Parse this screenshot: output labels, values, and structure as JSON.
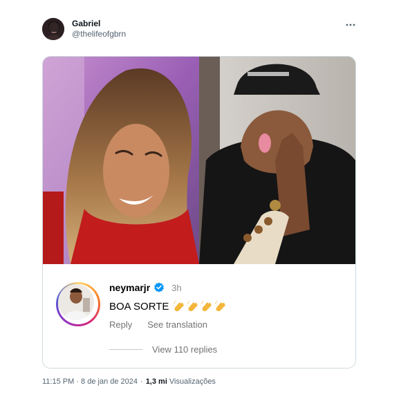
{
  "tweet": {
    "author_name": "Gabriel",
    "author_handle": "@thelifeofgbrn",
    "timestamp": "11:15 PM · 8 de jan de 2024",
    "views_count": "1,3 mi",
    "views_label": "Visualizações"
  },
  "comment": {
    "username": "neymarjr",
    "time": "3h",
    "text": "BOA SORTE",
    "emoji_count": 4,
    "reply_label": "Reply",
    "translate_label": "See translation",
    "view_replies_label": "View 110 replies"
  },
  "icons": {
    "more": "more-horizontal-icon",
    "verified": "verified-badge-icon",
    "emoji": "clapping-hands-emoji"
  },
  "colors": {
    "verified_blue": "#0095f6",
    "secondary_text": "#536471",
    "border": "#cfd9de"
  }
}
